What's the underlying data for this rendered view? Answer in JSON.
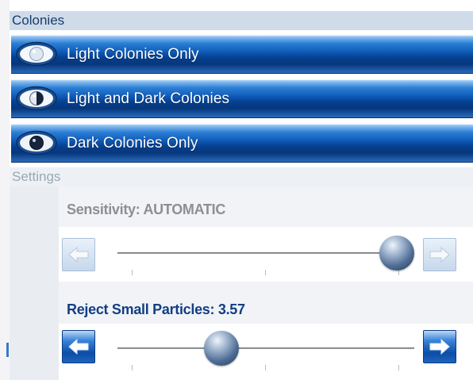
{
  "colonies": {
    "header": "Colonies",
    "options": [
      {
        "label": "Light Colonies Only",
        "icon": "light-colony-eye-icon"
      },
      {
        "label": "Light and Dark Colonies",
        "icon": "light-dark-colony-eye-icon"
      },
      {
        "label": "Dark Colonies Only",
        "icon": "dark-colony-eye-icon"
      }
    ]
  },
  "settings": {
    "header": "Settings",
    "sliders": [
      {
        "label": "Sensitivity: AUTOMATIC",
        "value_fraction": 0.94,
        "enabled": false,
        "left_icon": "arrow-left-icon",
        "right_icon": "arrow-right-icon"
      },
      {
        "label": "Reject Small Particles: 3.57",
        "value_fraction": 0.35,
        "enabled": true,
        "left_icon": "arrow-left-icon",
        "right_icon": "arrow-right-icon"
      }
    ]
  },
  "colors": {
    "accent_blue": "#0d58b6",
    "header_active_text": "#173d6b",
    "header_inactive_text": "#9ba7b3",
    "label_disabled": "#8c8f94",
    "label_enabled": "#123e85"
  }
}
